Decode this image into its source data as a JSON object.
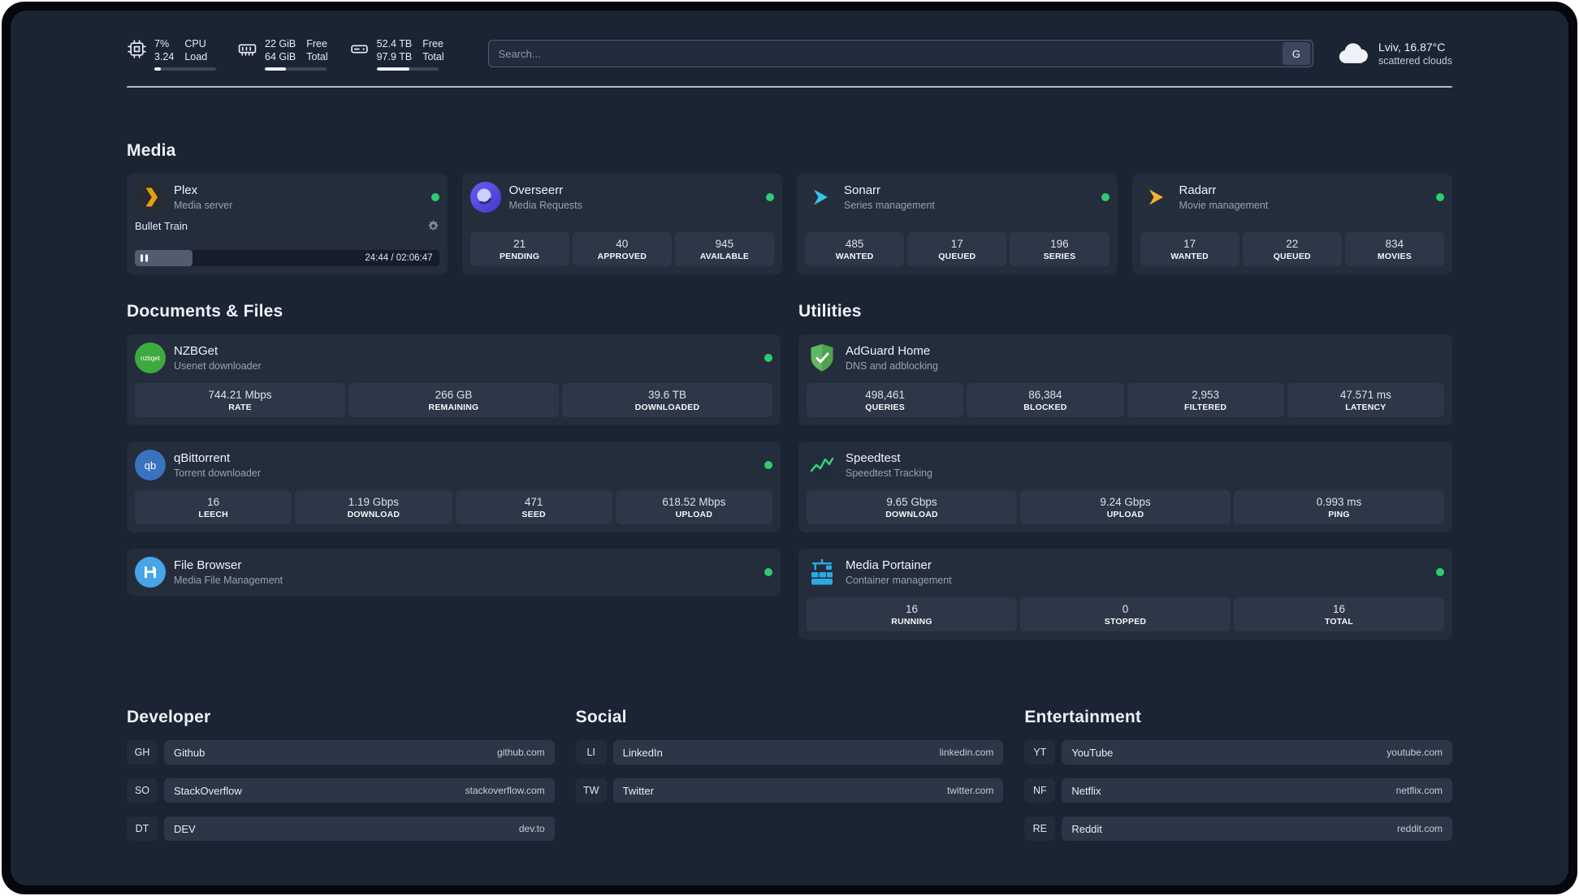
{
  "topbar": {
    "cpu": {
      "value_top": "7%",
      "value_bottom": "3.24",
      "label_top": "CPU",
      "label_bottom": "Load",
      "progress": 10
    },
    "memory": {
      "value_top": "22 GiB",
      "value_bottom": "64 GiB",
      "label_top": "Free",
      "label_bottom": "Total",
      "progress": 34
    },
    "disk": {
      "value_top": "52.4 TB",
      "value_bottom": "97.9 TB",
      "label_top": "Free",
      "label_bottom": "Total",
      "progress": 53
    },
    "search": {
      "placeholder": "Search...",
      "provider_button": "G"
    },
    "weather": {
      "location": "Lviv, 16.87°C",
      "condition": "scattered clouds"
    }
  },
  "sections": {
    "media": {
      "title": "Media",
      "cards": [
        {
          "name": "Plex",
          "subtitle": "Media server",
          "status": "online",
          "now_playing": {
            "title": "Bullet Train",
            "time_display": "24:44 / 02:06:47",
            "progress": 19
          }
        },
        {
          "name": "Overseerr",
          "subtitle": "Media Requests",
          "status": "online",
          "stats": [
            {
              "value": "21",
              "label": "PENDING"
            },
            {
              "value": "40",
              "label": "APPROVED"
            },
            {
              "value": "945",
              "label": "AVAILABLE"
            }
          ]
        },
        {
          "name": "Sonarr",
          "subtitle": "Series management",
          "status": "online",
          "stats": [
            {
              "value": "485",
              "label": "WANTED"
            },
            {
              "value": "17",
              "label": "QUEUED"
            },
            {
              "value": "196",
              "label": "SERIES"
            }
          ]
        },
        {
          "name": "Radarr",
          "subtitle": "Movie management",
          "status": "online",
          "stats": [
            {
              "value": "17",
              "label": "WANTED"
            },
            {
              "value": "22",
              "label": "QUEUED"
            },
            {
              "value": "834",
              "label": "MOVIES"
            }
          ]
        }
      ]
    },
    "documents": {
      "title": "Documents & Files",
      "cards": [
        {
          "name": "NZBGet",
          "subtitle": "Usenet downloader",
          "status": "online",
          "icon_text": "nzbget",
          "stats": [
            {
              "value": "744.21 Mbps",
              "label": "RATE"
            },
            {
              "value": "266 GB",
              "label": "REMAINING"
            },
            {
              "value": "39.6 TB",
              "label": "DOWNLOADED"
            }
          ]
        },
        {
          "name": "qBittorrent",
          "subtitle": "Torrent downloader",
          "status": "online",
          "icon_text": "qb",
          "stats": [
            {
              "value": "16",
              "label": "LEECH"
            },
            {
              "value": "1.19 Gbps",
              "label": "DOWNLOAD"
            },
            {
              "value": "471",
              "label": "SEED"
            },
            {
              "value": "618.52 Mbps",
              "label": "UPLOAD"
            }
          ]
        },
        {
          "name": "File Browser",
          "subtitle": "Media File Management",
          "status": "online",
          "stats": []
        }
      ]
    },
    "utilities": {
      "title": "Utilities",
      "cards": [
        {
          "name": "AdGuard Home",
          "subtitle": "DNS and adblocking",
          "stats": [
            {
              "value": "498,461",
              "label": "QUERIES"
            },
            {
              "value": "86,384",
              "label": "BLOCKED"
            },
            {
              "value": "2,953",
              "label": "FILTERED"
            },
            {
              "value": "47.571 ms",
              "label": "LATENCY"
            }
          ]
        },
        {
          "name": "Speedtest",
          "subtitle": "Speedtest Tracking",
          "stats": [
            {
              "value": "9.65 Gbps",
              "label": "DOWNLOAD"
            },
            {
              "value": "9.24 Gbps",
              "label": "UPLOAD"
            },
            {
              "value": "0.993 ms",
              "label": "PING"
            }
          ]
        },
        {
          "name": "Media Portainer",
          "subtitle": "Container management",
          "status": "online",
          "stats": [
            {
              "value": "16",
              "label": "RUNNING"
            },
            {
              "value": "0",
              "label": "STOPPED"
            },
            {
              "value": "16",
              "label": "TOTAL"
            }
          ]
        }
      ]
    }
  },
  "bookmarks": [
    {
      "title": "Developer",
      "items": [
        {
          "abbr": "GH",
          "name": "Github",
          "url": "github.com"
        },
        {
          "abbr": "SO",
          "name": "StackOverflow",
          "url": "stackoverflow.com"
        },
        {
          "abbr": "DT",
          "name": "DEV",
          "url": "dev.to"
        }
      ]
    },
    {
      "title": "Social",
      "items": [
        {
          "abbr": "LI",
          "name": "LinkedIn",
          "url": "linkedin.com"
        },
        {
          "abbr": "TW",
          "name": "Twitter",
          "url": "twitter.com"
        }
      ]
    },
    {
      "title": "Entertainment",
      "items": [
        {
          "abbr": "YT",
          "name": "YouTube",
          "url": "youtube.com"
        },
        {
          "abbr": "NF",
          "name": "Netflix",
          "url": "netflix.com"
        },
        {
          "abbr": "RE",
          "name": "Reddit",
          "url": "reddit.com"
        }
      ]
    }
  ],
  "colors": {
    "background": "#1b2433",
    "card": "#242d3c",
    "tile": "#2d3747",
    "status_online": "#2fcb6e",
    "accent_plex": "#e5a00d"
  }
}
